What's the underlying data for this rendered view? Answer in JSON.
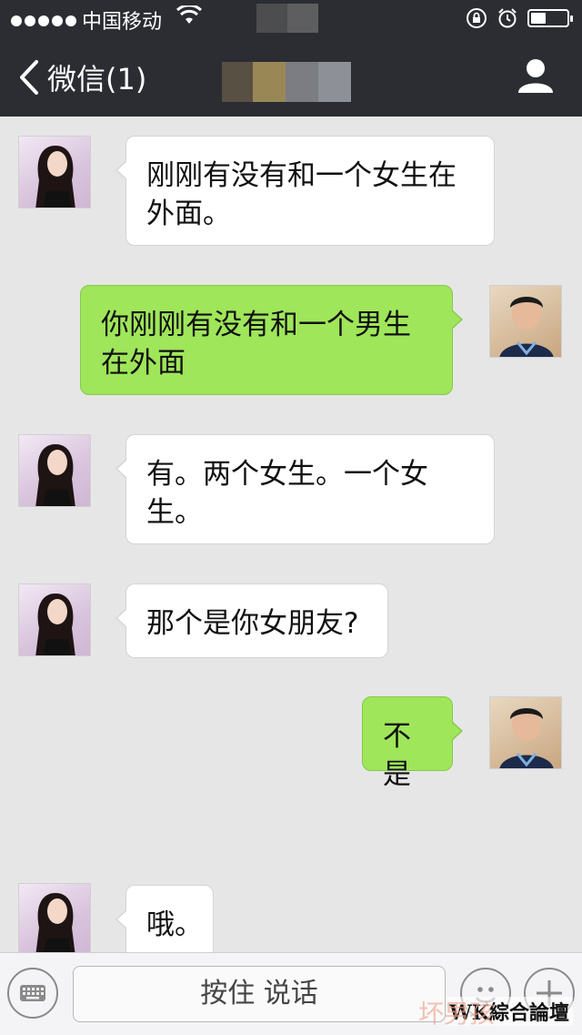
{
  "status_bar": {
    "carrier": "中国移动"
  },
  "nav": {
    "back_label": "微信(1)"
  },
  "messages": [
    {
      "side": "in",
      "text": "刚刚有没有和一个女生在外面。"
    },
    {
      "side": "out",
      "text": "你刚刚有没有和一个男生在外面"
    },
    {
      "side": "in",
      "text": "有。两个女生。一个女生。"
    },
    {
      "side": "in",
      "text": "那个是你女朋友?"
    },
    {
      "side": "out",
      "text": "不是"
    },
    {
      "side": "in",
      "text": "哦。"
    }
  ],
  "input_bar": {
    "hold_to_talk": "按住 说话"
  },
  "watermark": {
    "text": "WK綜合論壇",
    "secondary": "坏男孩"
  },
  "colors": {
    "nav_bg": "#2b2d33",
    "chat_bg": "#e6e6e6",
    "outgoing_bubble": "#9fe65a",
    "incoming_bubble": "#ffffff"
  }
}
